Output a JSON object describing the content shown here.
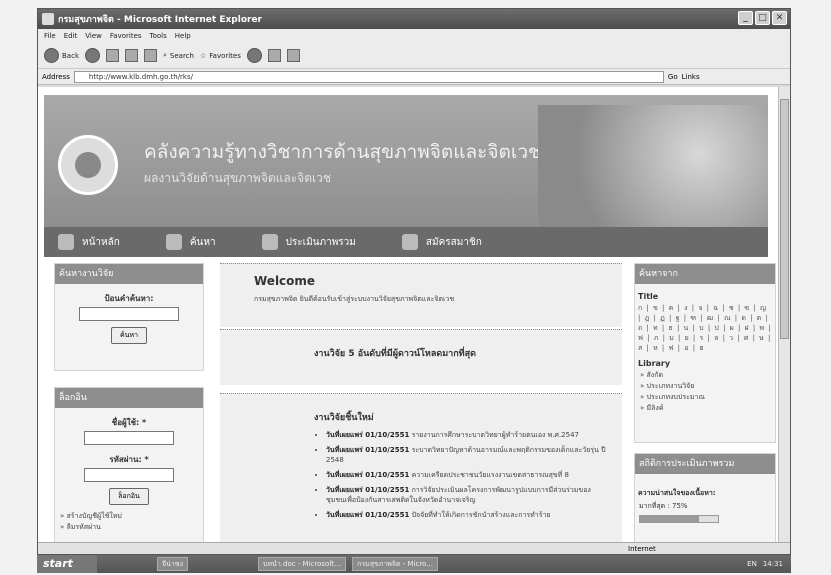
{
  "window": {
    "title": "กรมสุขภาพจิต - Microsoft Internet Explorer"
  },
  "menu": [
    "File",
    "Edit",
    "View",
    "Favorites",
    "Tools",
    "Help"
  ],
  "toolbar": {
    "back": "Back",
    "search": "Search",
    "favorites": "Favorites"
  },
  "address": {
    "label": "Address",
    "url": "http://www.klb.dmh.go.th/rks/",
    "go": "Go",
    "links": "Links"
  },
  "banner": {
    "line1": "คลังความรู้ทางวิชาการด้านสุขภาพจิตและจิตเวช",
    "line2": "ผลงานวิจัยด้านสุขภาพจิตและจิตเวช"
  },
  "nav": [
    "หน้าหลัก",
    "ค้นหา",
    "ประเมินภาพรวม",
    "สมัครสมาชิก"
  ],
  "search_panel": {
    "head": "ค้นหางานวิจัย",
    "label": "ป้อนคำค้นหา:",
    "button": "ค้นหา"
  },
  "login_panel": {
    "head": "ล็อกอิน",
    "user": "ชื่อผู้ใช้: *",
    "pass": "รหัสผ่าน: *",
    "button": "ล็อกอิน",
    "link1": "สร้างบัญชีผู้ใช้ใหม่",
    "link2": "ลืมรหัสผ่าน"
  },
  "welcome": {
    "title": "Welcome",
    "text": "กรมสุขภาพจิต ยินดีต้อนรับเข้าสู่ระบบงานวิจัยสุขภาพจิตและจิตเวช"
  },
  "top5": {
    "title": "งานวิจัย 5 อันดับที่มีผู้ดาวน์โหลดมากที่สุด"
  },
  "newest": {
    "title": "งานวิจัยชิ้นใหม่",
    "items": [
      {
        "date": "วันที่เผยแพร่ 01/10/2551",
        "text": "รายงานการศึกษาระบาดวิทยาผู้ทำร้ายตนเอง พ.ศ.2547"
      },
      {
        "date": "วันที่เผยแพร่ 01/10/2551",
        "text": "ระบาดวิทยาปัญหาด้านอารมณ์และพฤติกรรมของเด็กและวัยรุ่น ปี 2548"
      },
      {
        "date": "วันที่เผยแพร่ 01/10/2551",
        "text": "ความเครียดประชาชนวัยแรงงานเขตสาธารณสุขที่ 8"
      },
      {
        "date": "วันที่เผยแพร่ 01/10/2551",
        "text": "การวิจัยประเมินผลโครงการพัฒนารูปแบบการมีส่วนร่วมของชุมชนเพื่อป้องกันสารเสพติดในจังหวัดอำนาจเจริญ"
      },
      {
        "date": "วันที่เผยแพร่ 01/10/2551",
        "text": "ปัจจัยที่ทำให้เกิดการชักนำสร้างและการทำร้าย"
      }
    ]
  },
  "right_panel": {
    "head": "ค้นหาจาก",
    "title_head": "Title",
    "letters": "ก | ข | ค | ง | จ | ฉ | ช | ซ | ญ | ฎ | ฏ | ฐ | ฑ | ฒ | ณ | ด | ต | ถ | ท | ธ | น | บ | ป | ผ | ฝ | พ | ฟ | ภ | ม | ย | ร | ล | ว | ศ | ษ | ส | ห | ฟ | อ | ฮ",
    "lib_head": "Library",
    "lib": [
      "สังกัด",
      "ประเภทงานวิจัย",
      "ประเภทงบประมาณ",
      "มีลิงค์"
    ]
  },
  "stats_panel": {
    "head": "สถิติการประเมินภาพรวม",
    "label": "ความน่าสนใจของเนื้อหา:",
    "value": "มากที่สุด : 75%",
    "level": 0.75
  },
  "status": {
    "zone": "Internet"
  },
  "taskbar": {
    "start": "start",
    "tasks": [
      "จีน่าซง",
      "บทนำ.doc - Microsoft...",
      "กรมสุขภาพจิต - Micro..."
    ],
    "lang": "EN",
    "time": "14:31"
  }
}
